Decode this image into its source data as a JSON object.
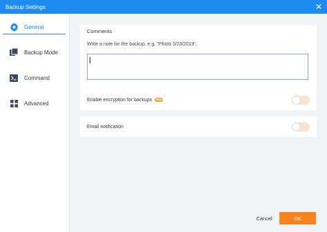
{
  "window": {
    "title": "Backup Settings",
    "close_glyph": "✕"
  },
  "sidebar": {
    "items": [
      {
        "label": "General",
        "icon": "gear-icon",
        "active": true
      },
      {
        "label": "Backup Mode",
        "icon": "backup-mode-icon",
        "active": false
      },
      {
        "label": "Command",
        "icon": "command-icon",
        "active": false
      },
      {
        "label": "Advanced",
        "icon": "advanced-icon",
        "active": false
      }
    ]
  },
  "comments": {
    "title": "Comments",
    "hint": "Write a note for the backup, e.g. \"Photo 3/23/2019\".",
    "value": ""
  },
  "encryption": {
    "label": "Enable encryption for backups",
    "badge": "PRO",
    "enabled": false
  },
  "email": {
    "label": "Email notification",
    "enabled": false
  },
  "footer": {
    "cancel_label": "Cancel",
    "ok_label": "OK"
  },
  "colors": {
    "accent": "#1e8bf0",
    "ok_button": "#f7821e",
    "content_bg": "#f1f3f7",
    "toggle_off": "#fbe2cc"
  }
}
